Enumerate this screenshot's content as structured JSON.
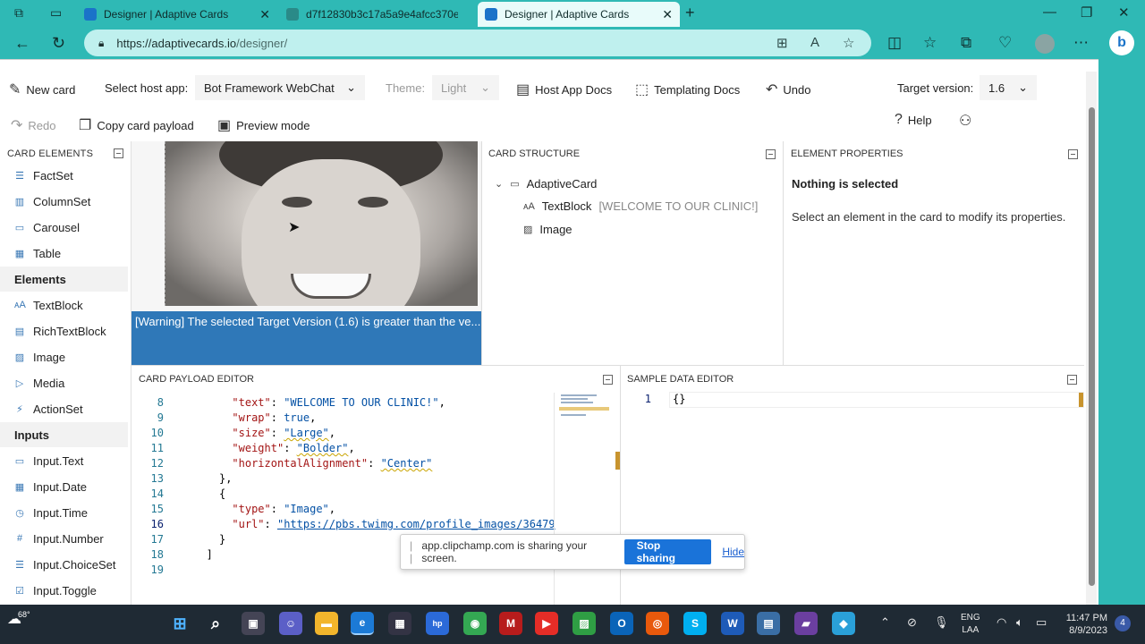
{
  "browser": {
    "tabs": [
      {
        "label": "Designer | Adaptive Cards",
        "active": false
      },
      {
        "label": "d7f12830b3c17a5a9e4afcc370e1",
        "active": false
      },
      {
        "label": "Designer | Adaptive Cards",
        "active": true
      }
    ],
    "url_host": "https://adaptivecards.io",
    "url_path": "/designer/",
    "colors": {
      "chrome": "#2fb9b5",
      "accent": "#1a73d9"
    }
  },
  "toolbar": {
    "new_card": "New card",
    "host_app_label": "Select host app:",
    "host_app_value": "Bot Framework WebChat",
    "theme_label": "Theme:",
    "theme_value": "Light",
    "host_app_docs": "Host App Docs",
    "templating_docs": "Templating Docs",
    "undo": "Undo",
    "target_version_label": "Target version:",
    "target_version_value": "1.6",
    "redo": "Redo",
    "copy_payload": "Copy card payload",
    "preview_mode": "Preview mode",
    "help": "Help"
  },
  "palette": {
    "header": "CARD ELEMENTS",
    "container_items": [
      "FactSet",
      "ColumnSet",
      "Carousel",
      "Table"
    ],
    "elements_group": "Elements",
    "element_items": [
      "TextBlock",
      "RichTextBlock",
      "Image",
      "Media",
      "ActionSet"
    ],
    "inputs_group": "Inputs",
    "input_items": [
      "Input.Text",
      "Input.Date",
      "Input.Time",
      "Input.Number",
      "Input.ChoiceSet",
      "Input.Toggle"
    ]
  },
  "preview": {
    "warning": "[Warning] The selected Target Version (1.6) is greater than the ve..."
  },
  "structure": {
    "header": "CARD STRUCTURE",
    "root": "AdaptiveCard",
    "text_block": "TextBlock",
    "text_block_value": "[WELCOME TO OUR CLINIC!]",
    "image": "Image"
  },
  "properties": {
    "header": "ELEMENT PROPERTIES",
    "title": "Nothing is selected",
    "hint": "Select an element in the card to modify its properties."
  },
  "payload_editor": {
    "header": "CARD PAYLOAD EDITOR",
    "lines": [
      {
        "n": "8",
        "k": "\"text\"",
        "v": "\"WELCOME TO OUR CLINIC!\"",
        "end": ","
      },
      {
        "n": "9",
        "k": "\"wrap\"",
        "v": "true",
        "end": ","
      },
      {
        "n": "10",
        "k": "\"size\"",
        "v": "\"Large\"",
        "end": ","
      },
      {
        "n": "11",
        "k": "\"weight\"",
        "v": "\"Bolder\"",
        "end": ","
      },
      {
        "n": "12",
        "k": "\"horizontalAlignment\"",
        "v": "\"Center\"",
        "end": ""
      },
      {
        "n": "13",
        "raw": "},"
      },
      {
        "n": "14",
        "raw": "{"
      },
      {
        "n": "15",
        "k": "\"type\"",
        "v": "\"Image\"",
        "end": ","
      },
      {
        "n": "16",
        "k": "\"url\"",
        "v": "\"https://pbs.twimg.com/profile_images/36479",
        "end": ""
      },
      {
        "n": "17",
        "raw": "}"
      },
      {
        "n": "18",
        "raw": "]"
      },
      {
        "n": "19",
        "raw": ""
      }
    ]
  },
  "sample_editor": {
    "header": "SAMPLE DATA EDITOR",
    "line_no": "1",
    "content": "{}"
  },
  "share_toast": {
    "message": "app.clipchamp.com is sharing your screen.",
    "stop": "Stop sharing",
    "hide": "Hide"
  },
  "taskbar": {
    "temperature": "68°",
    "lang_top": "ENG",
    "lang_bottom": "LAA",
    "time": "11:47 PM",
    "date": "8/9/2023",
    "notifications": "4"
  }
}
